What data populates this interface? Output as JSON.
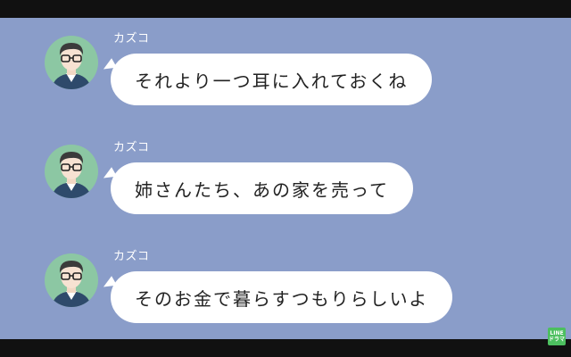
{
  "messages": [
    {
      "sender": "カズコ",
      "text": "それより一つ耳に入れておくね"
    },
    {
      "sender": "カズコ",
      "text": "姉さんたち、あの家を売って"
    },
    {
      "sender": "カズコ",
      "text": "そのお金で暮らすつもりらしいよ"
    }
  ],
  "logo": {
    "line1": "LINE",
    "line2": "ドラマ"
  },
  "colors": {
    "chat_background": "#8a9dc9",
    "bubble": "#ffffff",
    "avatar_background": "#8cc7a3",
    "logo": "#4cbf5f"
  }
}
